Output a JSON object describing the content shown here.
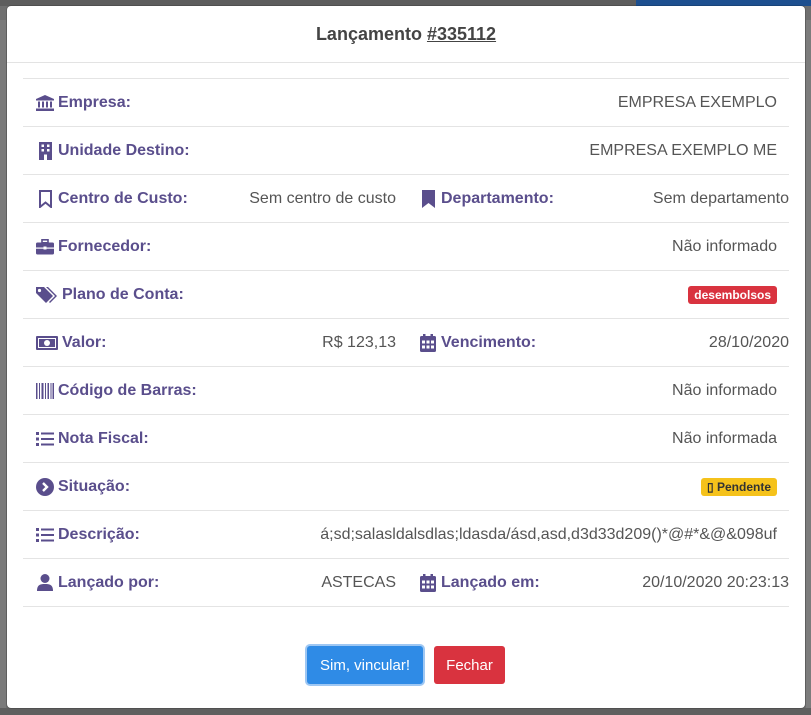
{
  "modal": {
    "title_prefix": "Lançamento",
    "title_number": "#335112"
  },
  "fields": {
    "empresa": {
      "label": "Empresa:",
      "value": "EMPRESA EXEMPLO",
      "icon": "bank-icon"
    },
    "unidade": {
      "label": "Unidade Destino:",
      "value": "EMPRESA EXEMPLO ME",
      "icon": "building-icon"
    },
    "centro_custo": {
      "label": "Centro de Custo:",
      "value": "Sem centro de custo",
      "icon": "bookmark-outline-icon"
    },
    "departamento": {
      "label": "Departamento:",
      "value": "Sem departamento",
      "icon": "bookmark-icon"
    },
    "fornecedor": {
      "label": "Fornecedor:",
      "value": "Não informado",
      "icon": "briefcase-icon"
    },
    "plano_conta": {
      "label": "Plano de Conta:",
      "badge": "desembolsos",
      "icon": "tags-icon"
    },
    "valor": {
      "label": "Valor:",
      "value": "R$ 123,13",
      "icon": "money-bill-icon"
    },
    "vencimento": {
      "label": "Vencimento:",
      "value": "28/10/2020",
      "icon": "calendar-icon"
    },
    "codigo_barras": {
      "label": "Código de Barras:",
      "value": "Não informado",
      "icon": "barcode-icon"
    },
    "nota_fiscal": {
      "label": "Nota Fiscal:",
      "value": "Não informada",
      "icon": "list-icon"
    },
    "situacao": {
      "label": "Situação:",
      "badge": "Pendente",
      "badge_glyph": "▯",
      "icon": "chevron-circle-right-icon"
    },
    "descricao": {
      "label": "Descrição:",
      "value": "á;sd;salasldalsdlas;ldasda/ásd,asd,d3d33d209()*@#*&@&098uf",
      "icon": "list-icon"
    },
    "lancado_por": {
      "label": "Lançado por:",
      "value": "ASTECAS",
      "icon": "user-icon"
    },
    "lancado_em": {
      "label": "Lançado em:",
      "value": "20/10/2020 20:23:13",
      "icon": "calendar-icon"
    }
  },
  "buttons": {
    "confirm": "Sim, vincular!",
    "close": "Fechar"
  },
  "colors": {
    "label": "#5a4e8c",
    "primary": "#2f8be6",
    "danger": "#d9333f",
    "warning": "#f5c21b"
  }
}
